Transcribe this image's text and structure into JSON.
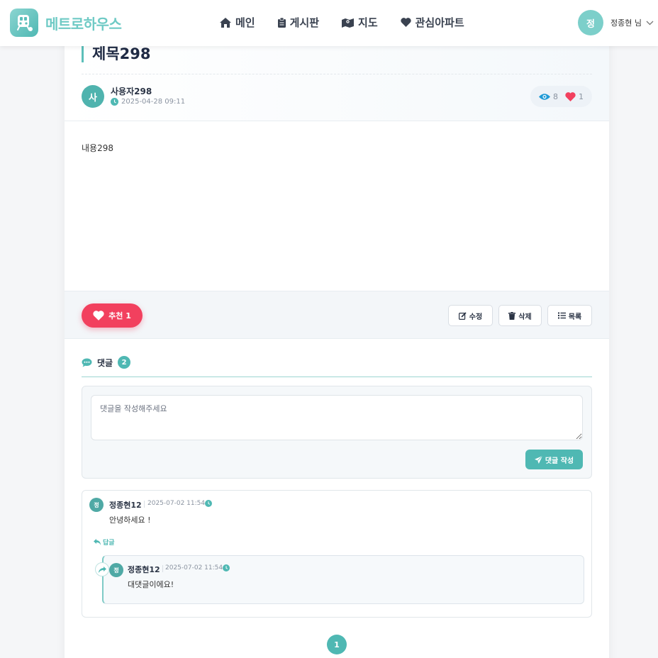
{
  "header": {
    "logo_text": "메트로하우스",
    "nav": [
      {
        "label": "메인",
        "icon": "home-icon"
      },
      {
        "label": "게시판",
        "icon": "clipboard-icon"
      },
      {
        "label": "지도",
        "icon": "map-icon"
      },
      {
        "label": "관심아파트",
        "icon": "heart-icon"
      }
    ],
    "user": {
      "avatar": "정",
      "name": "정종현 님"
    }
  },
  "post": {
    "title": "제목298",
    "author_avatar": "사",
    "author": "사용자298",
    "date": "2025-04-28 09:11",
    "views": "8",
    "likes": "1",
    "content": "내용298"
  },
  "actions": {
    "like_label": "추천 1",
    "edit": "수정",
    "delete": "삭제",
    "list": "목록"
  },
  "comments": {
    "title": "댓글",
    "count": "2",
    "placeholder": "댓글을 작성해주세요",
    "submit": "댓글 작성",
    "reply_label": "답글",
    "items": [
      {
        "avatar": "정",
        "author": "정종현12",
        "date": "2025-07-02 11:54",
        "text": "안녕하세요 !"
      }
    ],
    "replies": [
      {
        "avatar": "정",
        "author": "정종현12",
        "date": "2025-07-02 11:54",
        "text": "대댓글이에요!"
      }
    ]
  },
  "pagination": {
    "current": "1"
  },
  "colors": {
    "accent": "#4fb8b3",
    "like": "#f2405e",
    "title": "#1f2a44"
  }
}
